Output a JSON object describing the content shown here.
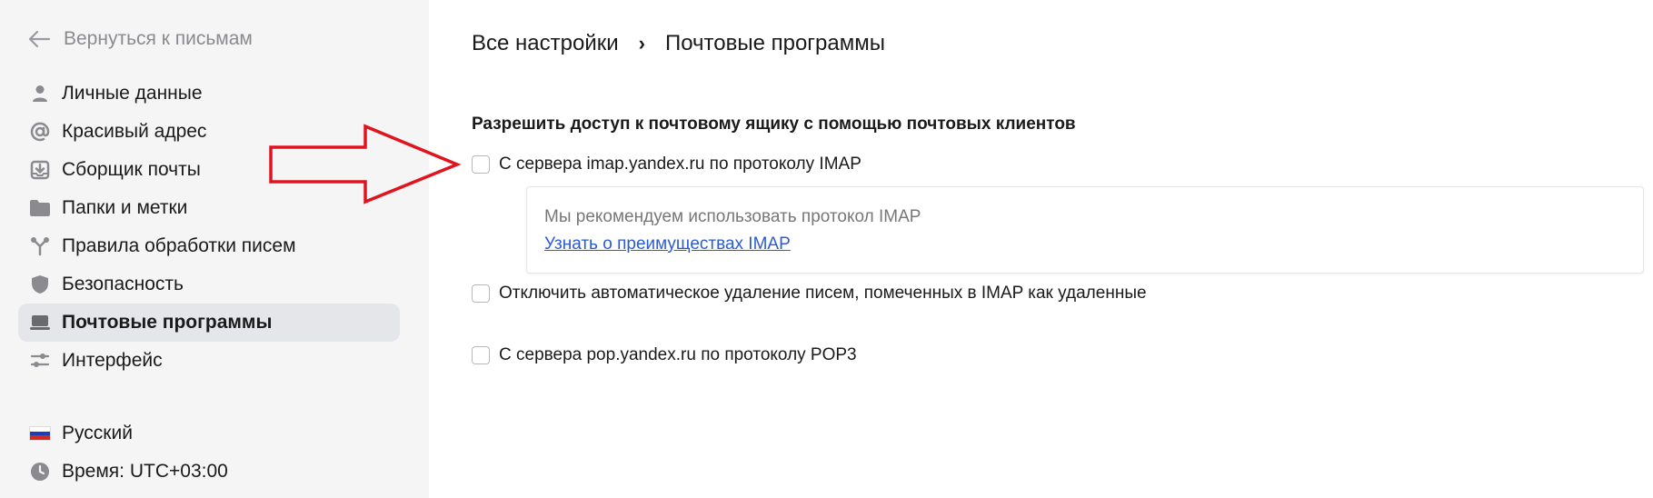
{
  "sidebar": {
    "back_label": "Вернуться к письмам",
    "items": [
      {
        "label": "Личные данные",
        "icon": "user-icon"
      },
      {
        "label": "Красивый адрес",
        "icon": "at-icon"
      },
      {
        "label": "Сборщик почты",
        "icon": "inbox-download-icon"
      },
      {
        "label": "Папки и метки",
        "icon": "folder-icon"
      },
      {
        "label": "Правила обработки писем",
        "icon": "rules-icon"
      },
      {
        "label": "Безопасность",
        "icon": "shield-icon"
      },
      {
        "label": "Почтовые программы",
        "icon": "laptop-icon",
        "active": true
      },
      {
        "label": "Интерфейс",
        "icon": "sliders-icon"
      }
    ],
    "language": "Русский",
    "timezone": "Время: UTC+03:00"
  },
  "breadcrumb": {
    "root": "Все настройки",
    "separator": "›",
    "current": "Почтовые программы"
  },
  "main": {
    "section_title": "Разрешить доступ к почтовому ящику с помощью почтовых клиентов",
    "imap_option": "С сервера imap.yandex.ru по протоколу IMAP",
    "imap_info_text": "Мы рекомендуем использовать протокол IMAP",
    "imap_info_link": "Узнать о преимуществах IMAP",
    "disable_autodelete_option": "Отключить автоматическое удаление писем, помеченных в IMAP как удаленные",
    "pop3_option": "С сервера pop.yandex.ru по протоколу POP3"
  },
  "colors": {
    "sidebar_bg": "#f5f5f6",
    "active_item_bg": "#e5e6ea",
    "link": "#2a5bd7",
    "annotation_arrow": "#e0141e",
    "flag": [
      "#ffffff",
      "#1c3fb8",
      "#d52b1e"
    ]
  }
}
